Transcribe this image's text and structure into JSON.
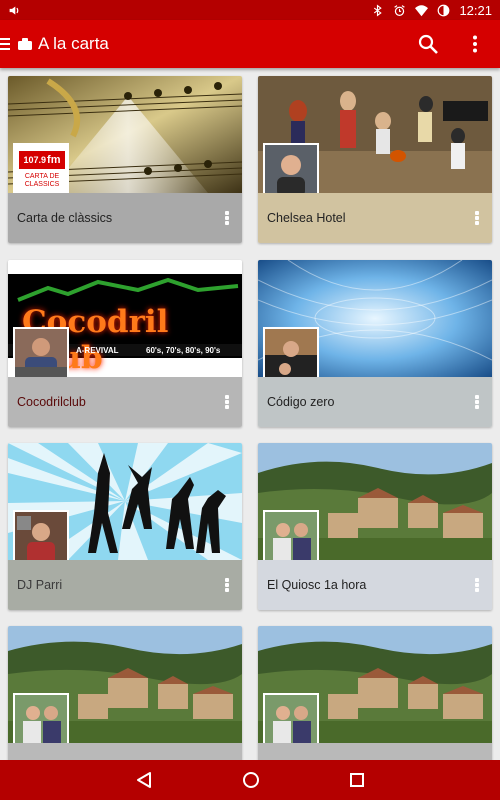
{
  "status_bar": {
    "time": "12:21",
    "icons": [
      "volume-icon",
      "bluetooth-icon",
      "alarm-icon",
      "wifi-icon",
      "battery-icon"
    ]
  },
  "app_bar": {
    "title": "A la carta",
    "icons": [
      "menu-icon",
      "folder-icon",
      "search-icon",
      "overflow-menu-icon"
    ]
  },
  "cards": [
    {
      "title": "Carta de clàssics",
      "caption_color": "#a9a9a9",
      "title_color": "#222222",
      "logo_text_1": "107.9",
      "logo_text_2": "fm",
      "logo_caption": "CARTA DE CLASSICS"
    },
    {
      "title": "Chelsea Hotel",
      "caption_color": "#d1c3a0",
      "title_color": "#222222"
    },
    {
      "title": "Cocodrilclub",
      "caption_color": "#b6b6b6",
      "title_color": "#5a0a0a",
      "banner_text": "Cocodril Club",
      "banner_sub": "A-REVIVAL",
      "banner_decades": "60's, 70's, 80's, 90's"
    },
    {
      "title": "Código zero",
      "caption_color": "#bfc5c6",
      "title_color": "#222222"
    },
    {
      "title": "DJ Parri",
      "caption_color": "#a8aca4",
      "title_color": "#3a3a3a"
    },
    {
      "title": "El Quiosc 1a hora",
      "caption_color": "#d4d8df",
      "title_color": "#222222"
    },
    {
      "title": "",
      "caption_color": "#b9b9b9",
      "title_color": "#222222"
    },
    {
      "title": "",
      "caption_color": "#b9b9b9",
      "title_color": "#222222"
    }
  ],
  "nav_bar": {
    "icons": [
      "back-icon",
      "home-icon",
      "recents-icon"
    ]
  }
}
